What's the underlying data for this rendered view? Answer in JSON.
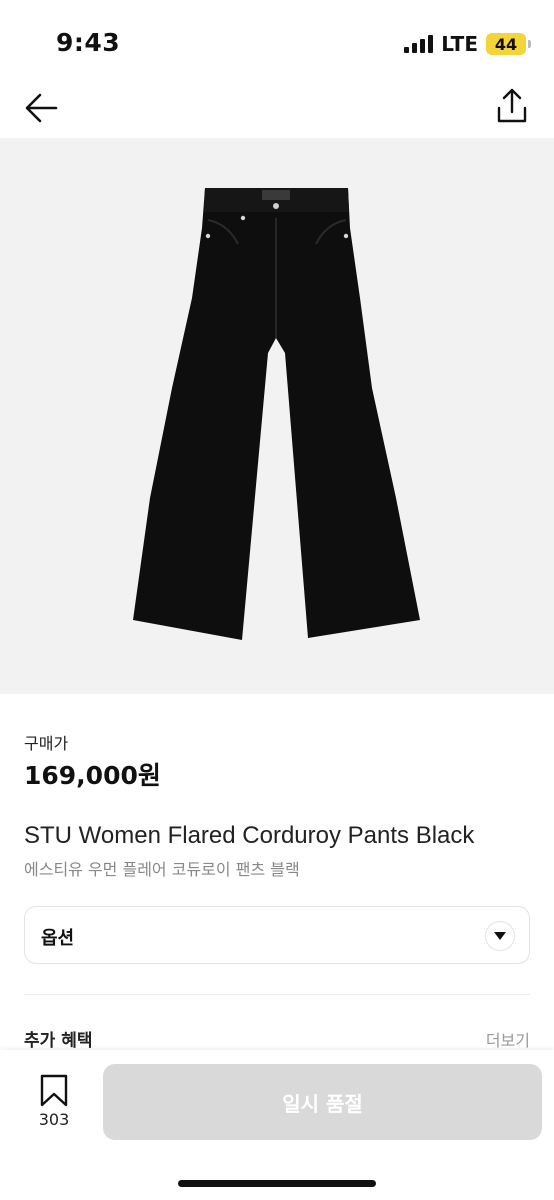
{
  "status_bar": {
    "time": "9:43",
    "network": "LTE",
    "battery_level": "44",
    "battery_color": "#f5d43a"
  },
  "nav": {
    "back_icon": "arrow-left-icon",
    "share_icon": "share-icon"
  },
  "product_image": {
    "background": "#f2f2f2",
    "subject": "black-flared-corduroy-pants"
  },
  "price": {
    "label": "구매가",
    "value": "169,000원"
  },
  "product": {
    "name": "STU Women Flared Corduroy Pants Black",
    "subname": "에스티유 우먼 플레어 코듀로이 팬츠 블랙"
  },
  "option": {
    "label": "옵션",
    "icon": "chevron-down-icon"
  },
  "benefits": {
    "title": "추가 혜택",
    "more": "더보기"
  },
  "bottom_bar": {
    "bookmark_icon": "bookmark-icon",
    "bookmark_count": "303",
    "soldout_label": "일시 품절",
    "button_color": "#d9d9d9"
  }
}
